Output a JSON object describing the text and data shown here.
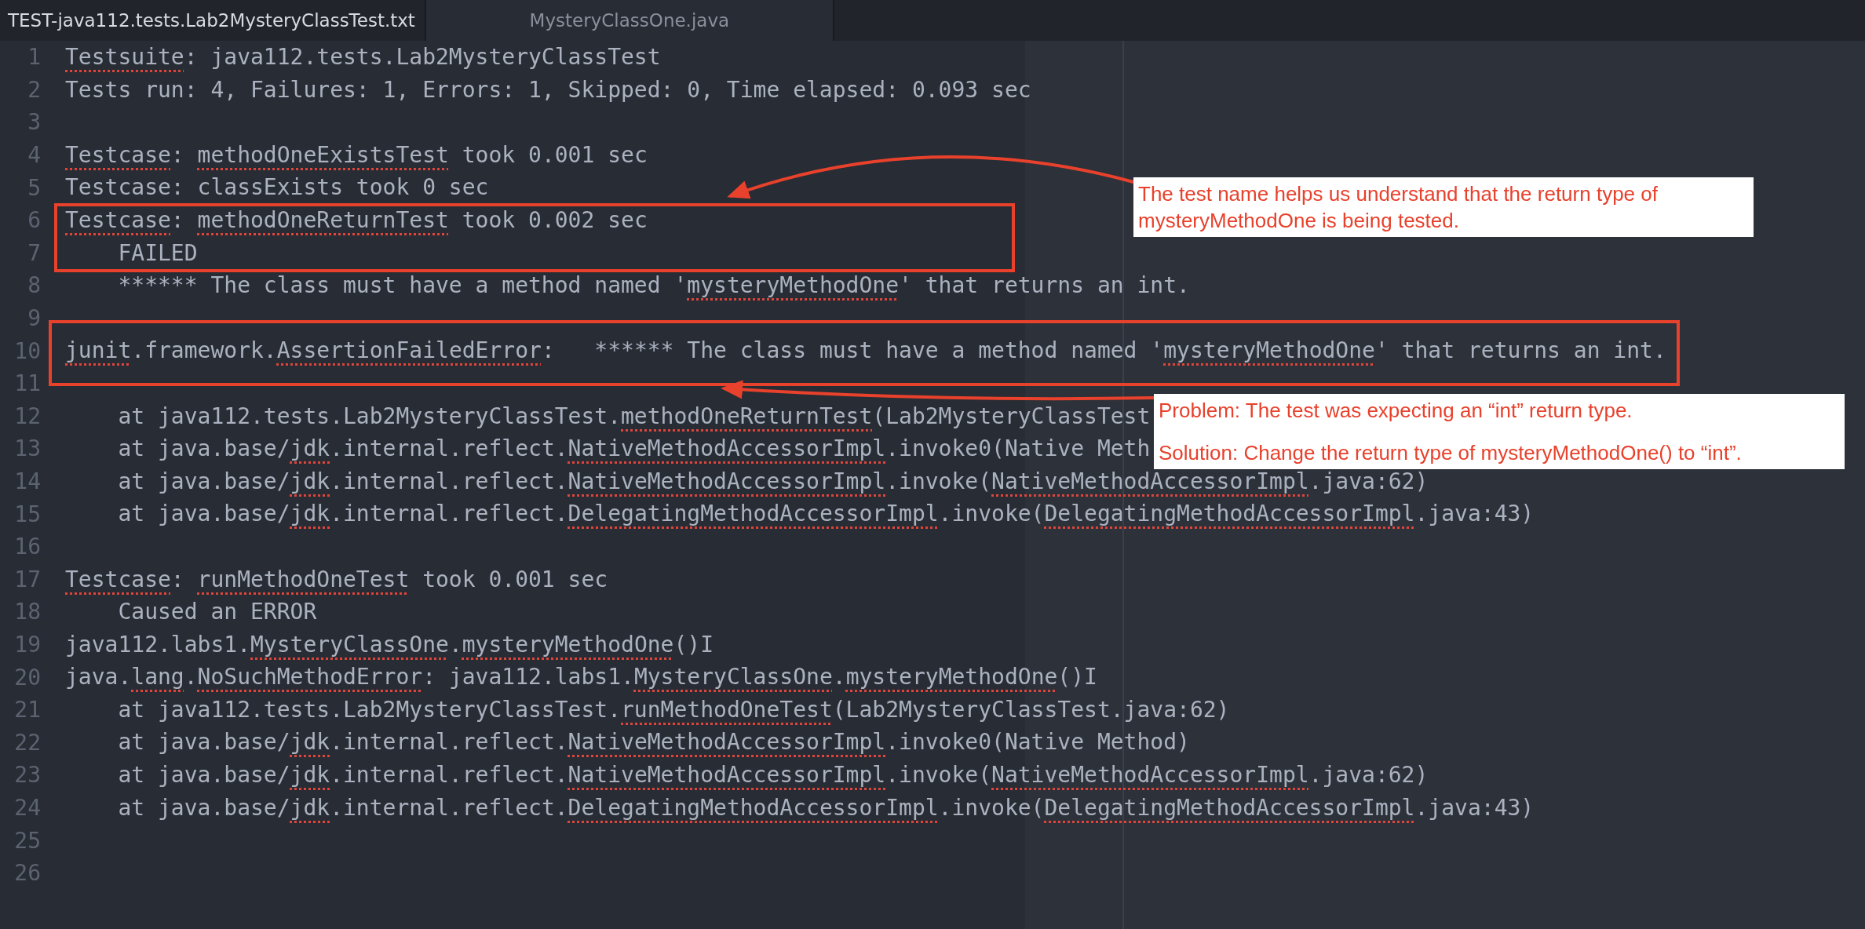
{
  "tabs": [
    {
      "label": "TEST-java112.tests.Lab2MysteryClassTest.txt",
      "selected": true
    },
    {
      "label": "MysteryClassOne.java",
      "selected": false
    }
  ],
  "editor": {
    "lines": [
      {
        "number": "1",
        "segments": [
          {
            "text": "Testsuite",
            "flagged": true
          },
          {
            "text": ": java112.tests.Lab2MysteryClassTest",
            "flagged": false
          }
        ]
      },
      {
        "number": "2",
        "segments": [
          {
            "text": "Tests run: 4, Failures: 1, Errors: 1, Skipped: 0, Time elapsed: 0.093 sec",
            "flagged": false
          }
        ]
      },
      {
        "number": "3"
      },
      {
        "number": "4",
        "segments": [
          {
            "text": "Testcase",
            "flagged": true
          },
          {
            "text": ": ",
            "flagged": false
          },
          {
            "text": "methodOneExistsTest",
            "flagged": true
          },
          {
            "text": " took 0.001 sec",
            "flagged": false
          }
        ]
      },
      {
        "number": "5",
        "segments": [
          {
            "text": "Testcase: classExists took 0 sec",
            "flagged": false
          }
        ]
      },
      {
        "number": "6",
        "segments": [
          {
            "text": "Testcase",
            "flagged": true
          },
          {
            "text": ": ",
            "flagged": false
          },
          {
            "text": "methodOneReturnTest",
            "flagged": true
          },
          {
            "text": " took 0.002 sec",
            "flagged": false
          }
        ]
      },
      {
        "number": "7",
        "segments": [
          {
            "text": "    FAILED",
            "flagged": false
          }
        ]
      },
      {
        "number": "8",
        "segments": [
          {
            "text": "    ****** The class must have a method named '",
            "flagged": false
          },
          {
            "text": "mysteryMethodOne",
            "flagged": true
          },
          {
            "text": "' that returns an int.",
            "flagged": false
          }
        ]
      },
      {
        "number": "9"
      },
      {
        "number": "10",
        "segments": [
          {
            "text": "junit",
            "flagged": true
          },
          {
            "text": ".framework.",
            "flagged": false
          },
          {
            "text": "AssertionFailedError",
            "flagged": true
          },
          {
            "text": ":   ****** The class must have a method named '",
            "flagged": false
          },
          {
            "text": "mysteryMethodOne",
            "flagged": true
          },
          {
            "text": "' that returns an int.",
            "flagged": false
          }
        ]
      },
      {
        "number": "11"
      },
      {
        "number": "12",
        "segments": [
          {
            "text": "    at java112.tests.Lab2MysteryClassTest.",
            "flagged": false
          },
          {
            "text": "methodOneReturnTest",
            "flagged": true
          },
          {
            "text": "(Lab2MysteryClassTest",
            "flagged": false
          }
        ]
      },
      {
        "number": "13",
        "segments": [
          {
            "text": "    at java.base/",
            "flagged": false
          },
          {
            "text": "jdk",
            "flagged": true
          },
          {
            "text": ".internal.reflect.",
            "flagged": false
          },
          {
            "text": "NativeMethodAccessorImpl",
            "flagged": true
          },
          {
            "text": ".invoke0(Native Meth",
            "flagged": false
          }
        ]
      },
      {
        "number": "14",
        "segments": [
          {
            "text": "    at java.base/",
            "flagged": false
          },
          {
            "text": "jdk",
            "flagged": true
          },
          {
            "text": ".internal.reflect.",
            "flagged": false
          },
          {
            "text": "NativeMethodAccessorImpl",
            "flagged": true
          },
          {
            "text": ".invoke(",
            "flagged": false
          },
          {
            "text": "NativeMethodAccessorImpl",
            "flagged": true
          },
          {
            "text": ".java:62)",
            "flagged": false
          }
        ]
      },
      {
        "number": "15",
        "segments": [
          {
            "text": "    at java.base/",
            "flagged": false
          },
          {
            "text": "jdk",
            "flagged": true
          },
          {
            "text": ".internal.reflect.",
            "flagged": false
          },
          {
            "text": "DelegatingMethodAccessorImpl",
            "flagged": true
          },
          {
            "text": ".invoke(",
            "flagged": false
          },
          {
            "text": "DelegatingMethodAccessorImpl",
            "flagged": true
          },
          {
            "text": ".java:43)",
            "flagged": false
          }
        ]
      },
      {
        "number": "16"
      },
      {
        "number": "17",
        "segments": [
          {
            "text": "Testcase",
            "flagged": true
          },
          {
            "text": ": ",
            "flagged": false
          },
          {
            "text": "runMethodOneTest",
            "flagged": true
          },
          {
            "text": " took 0.001 sec",
            "flagged": false
          }
        ]
      },
      {
        "number": "18",
        "segments": [
          {
            "text": "    Caused an ERROR",
            "flagged": false
          }
        ]
      },
      {
        "number": "19",
        "segments": [
          {
            "text": "java112.labs1.",
            "flagged": false
          },
          {
            "text": "MysteryClassOne",
            "flagged": true,
            "tail": "."
          },
          {
            "text": "mysteryMethodOne",
            "flagged": true
          },
          {
            "text": "()I",
            "flagged": false
          }
        ]
      },
      {
        "number": "20",
        "segments": [
          {
            "text": "java.",
            "flagged": false
          },
          {
            "text": "lang",
            "flagged": true,
            "tail": "."
          },
          {
            "text": "NoSuchMethodError",
            "flagged": true
          },
          {
            "text": ": java112.labs1.",
            "flagged": false
          },
          {
            "text": "MysteryClassOne",
            "flagged": true,
            "tail": "."
          },
          {
            "text": "mysteryMethodOne",
            "flagged": true
          },
          {
            "text": "()I",
            "flagged": false
          }
        ]
      },
      {
        "number": "21",
        "segments": [
          {
            "text": "    at java112.tests.Lab2MysteryClassTest.",
            "flagged": false
          },
          {
            "text": "runMethodOneTest",
            "flagged": true
          },
          {
            "text": "(Lab2MysteryClassTest.java:62)",
            "flagged": false
          }
        ]
      },
      {
        "number": "22",
        "segments": [
          {
            "text": "    at java.base/",
            "flagged": false
          },
          {
            "text": "jdk",
            "flagged": true
          },
          {
            "text": ".internal.reflect.",
            "flagged": false
          },
          {
            "text": "NativeMethodAccessorImpl",
            "flagged": true
          },
          {
            "text": ".invoke0(Native Method)",
            "flagged": false
          }
        ]
      },
      {
        "number": "23",
        "segments": [
          {
            "text": "    at java.base/",
            "flagged": false
          },
          {
            "text": "jdk",
            "flagged": true
          },
          {
            "text": ".internal.reflect.",
            "flagged": false
          },
          {
            "text": "NativeMethodAccessorImpl",
            "flagged": true
          },
          {
            "text": ".invoke(",
            "flagged": false
          },
          {
            "text": "NativeMethodAccessorImpl",
            "flagged": true
          },
          {
            "text": ".java:62)",
            "flagged": false
          }
        ]
      },
      {
        "number": "24",
        "segments": [
          {
            "text": "    at java.base/",
            "flagged": false
          },
          {
            "text": "jdk",
            "flagged": true
          },
          {
            "text": ".internal.reflect.",
            "flagged": false
          },
          {
            "text": "DelegatingMethodAccessorImpl",
            "flagged": true
          },
          {
            "text": ".invoke(",
            "flagged": false
          },
          {
            "text": "DelegatingMethodAccessorImpl",
            "flagged": true
          },
          {
            "text": ".java:43)",
            "flagged": false
          }
        ]
      },
      {
        "number": "25"
      },
      {
        "number": "26"
      }
    ]
  },
  "annotations": {
    "callouts": [
      {
        "paragraphs": [
          "The test name helps us understand that the return type of\nmysteryMethodOne is being tested."
        ]
      },
      {
        "paragraphs": [
          "Problem:  The test was expecting an “int” return type.",
          "Solution: Change the return type of mysteryMethodOne() to “int”."
        ]
      }
    ]
  }
}
